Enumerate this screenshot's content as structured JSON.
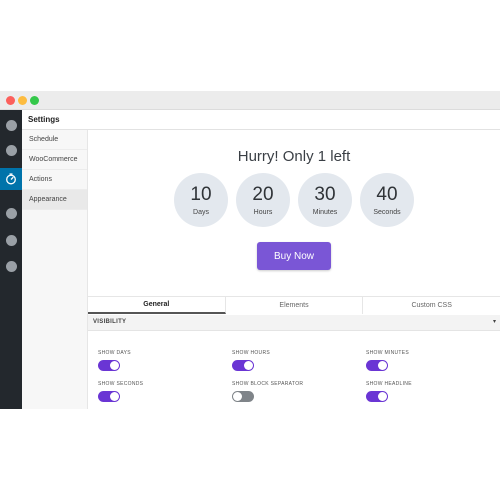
{
  "window": {
    "title": "Settings"
  },
  "sidebar_nav": {
    "items": [
      {
        "label": "Schedule",
        "active": false
      },
      {
        "label": "WooCommerce",
        "active": false
      },
      {
        "label": "Actions",
        "active": false
      },
      {
        "label": "Appearance",
        "active": true
      }
    ]
  },
  "preview": {
    "headline": "Hurry! Only 1 left",
    "countdown": [
      {
        "value": "10",
        "label": "Days"
      },
      {
        "value": "20",
        "label": "Hours"
      },
      {
        "value": "30",
        "label": "Minutes"
      },
      {
        "value": "40",
        "label": "Seconds"
      }
    ],
    "cta_label": "Buy Now"
  },
  "tabs": [
    {
      "label": "General",
      "active": true
    },
    {
      "label": "Elements",
      "active": false
    },
    {
      "label": "Custom CSS",
      "active": false
    }
  ],
  "visibility": {
    "section_title": "VISIBILITY",
    "caret": "▾",
    "toggles": [
      {
        "label": "SHOW DAYS",
        "on": true
      },
      {
        "label": "SHOW HOURS",
        "on": true
      },
      {
        "label": "SHOW MINUTES",
        "on": true
      },
      {
        "label": "SHOW SECONDS",
        "on": true
      },
      {
        "label": "SHOW BLOCK SEPARATOR",
        "on": false
      },
      {
        "label": "SHOW HEADLINE",
        "on": true
      }
    ]
  },
  "colors": {
    "accent": "#6a35d4",
    "cta": "#7a56d6",
    "rail": "#23282d",
    "rail_active": "#0073aa"
  }
}
